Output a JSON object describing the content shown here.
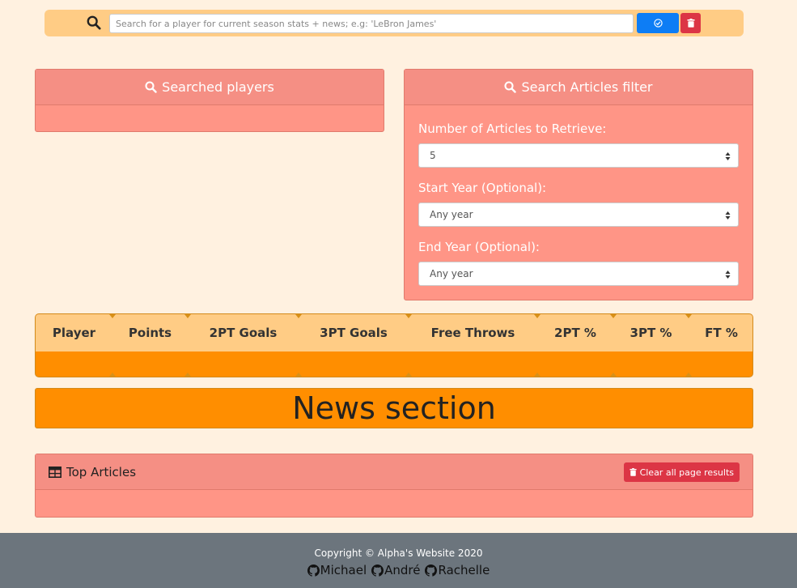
{
  "search": {
    "placeholder": "Search for a player for current season stats + news; e.g: 'LeBron James'",
    "submit_icon": "check-circle-icon",
    "delete_icon": "trash-icon"
  },
  "players_card": {
    "title": "Searched players"
  },
  "filter_card": {
    "title": "Search Articles filter",
    "fields": [
      {
        "label": "Number of Articles to Retrieve:",
        "value": "5"
      },
      {
        "label": "Start Year (Optional):",
        "value": "Any year"
      },
      {
        "label": "End Year (Optional):",
        "value": "Any year"
      }
    ]
  },
  "stats_table": {
    "columns": [
      "Player",
      "Points",
      "2PT Goals",
      "3PT Goals",
      "Free Throws",
      "2PT %",
      "3PT %",
      "FT %"
    ]
  },
  "news": {
    "heading": "News section"
  },
  "articles_card": {
    "title": "Top Articles",
    "clear_label": "Clear all page results"
  },
  "footer": {
    "copyright": "Copyright © Alpha's Website 2020",
    "links": [
      "Michael",
      "André",
      "Rachelle"
    ]
  },
  "colors": {
    "page_bg": "#fff1e0",
    "card_salmon": "#ff9586",
    "orange": "#ff8e00",
    "light_orange": "#ffcc85",
    "primary": "#0d7df5",
    "danger": "#dc3545",
    "footer_bg": "#6c757d"
  }
}
